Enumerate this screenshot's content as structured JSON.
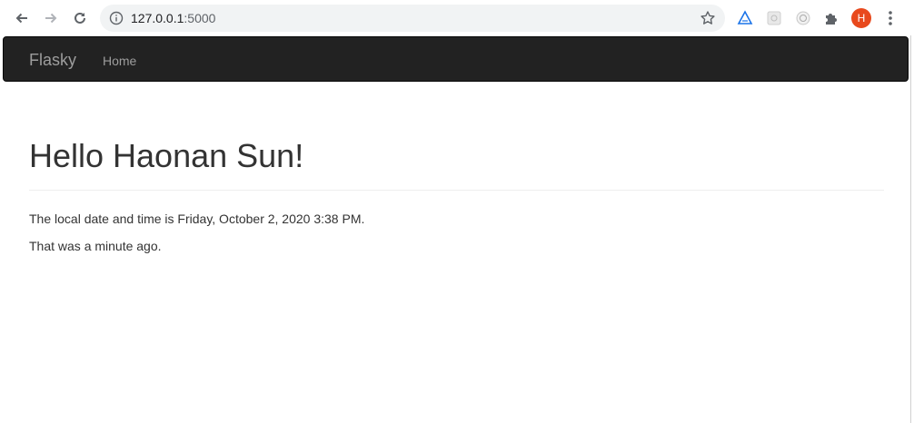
{
  "browser": {
    "url_host": "127.0.0.1",
    "url_port": ":5000",
    "avatar_initial": "H"
  },
  "navbar": {
    "brand": "Flasky",
    "home_label": "Home"
  },
  "main": {
    "heading": "Hello Haonan Sun!",
    "datetime_text": "The local date and time is Friday, October 2, 2020 3:38 PM.",
    "relative_text": "That was a minute ago."
  },
  "colors": {
    "navbar_bg": "#222222",
    "navbar_text": "#9d9d9d",
    "avatar_bg": "#e8491d"
  }
}
